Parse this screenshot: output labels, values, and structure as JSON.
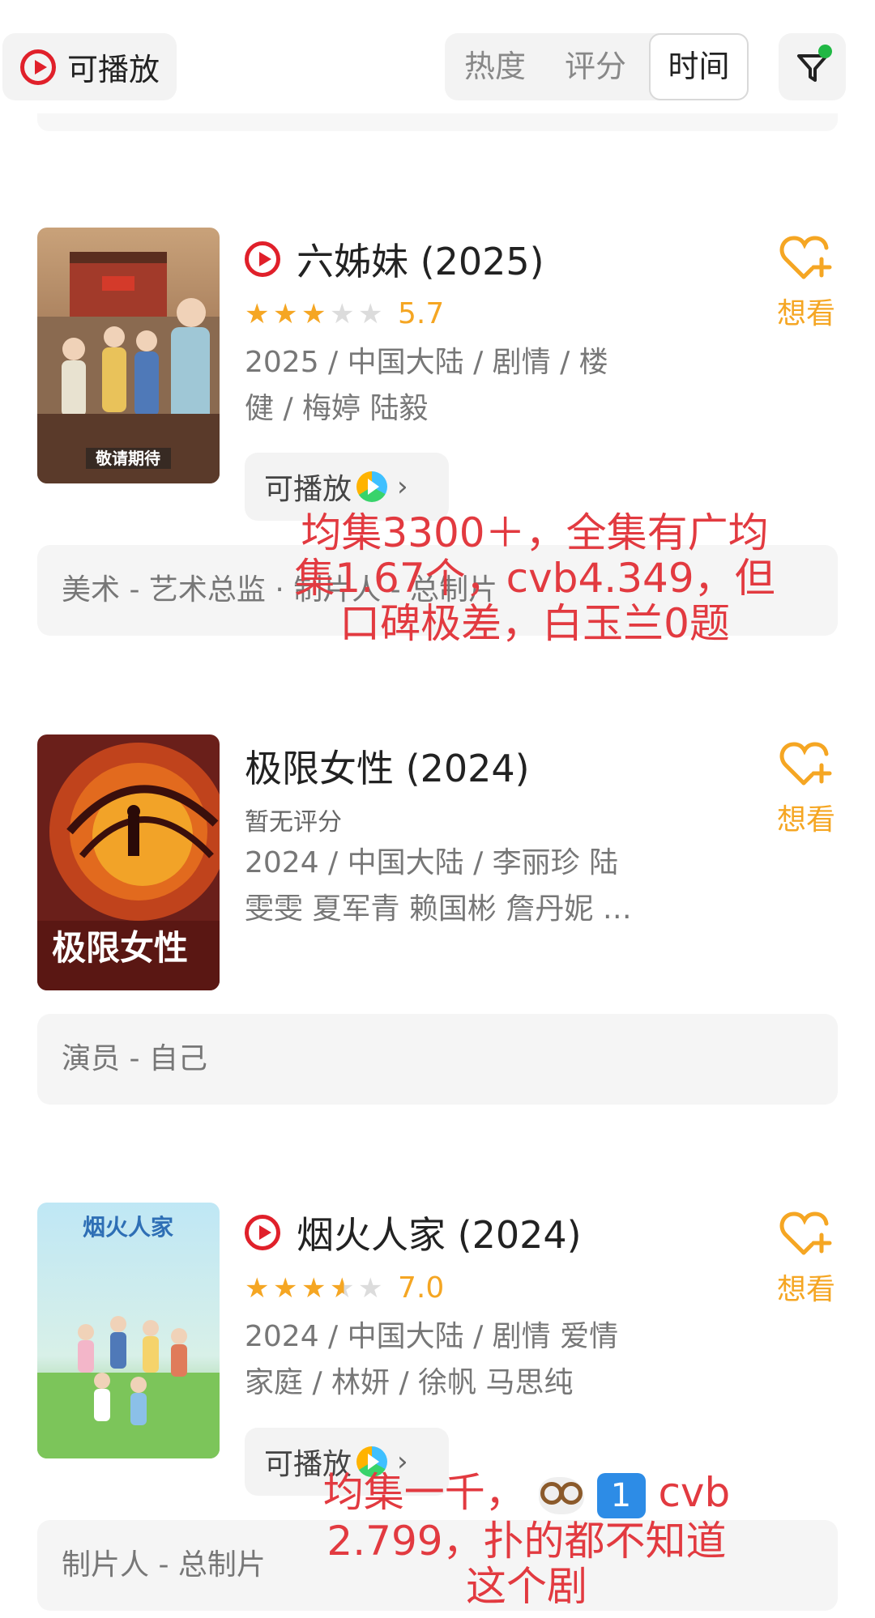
{
  "filter_bar": {
    "playable_label": "可播放",
    "sort_tabs": [
      "热度",
      "评分",
      "时间"
    ],
    "active_sort": "时间",
    "filter_icon": "filter-icon",
    "filter_dot_color": "#20b844"
  },
  "colors": {
    "accent": "#f5a623",
    "play_red": "#e0202a",
    "annotation_red": "#e23a40"
  },
  "items": [
    {
      "title": "六姊妹 (2025)",
      "has_play_badge": true,
      "rating_stars": 3,
      "score": "5.7",
      "info_line1": "2025 / 中国大陆 / 剧情 / 楼",
      "info_line2": "健 / 梅婷 陆毅",
      "play_chip": "可播放",
      "wish_label": "想看",
      "role": "美术 - 艺术总监 · 制片人 - 总制片",
      "poster_text": "敬请期待"
    },
    {
      "title": "极限女性 (2024)",
      "has_play_badge": false,
      "no_rating": "暂无评分",
      "info_line1": "2024 / 中国大陆 / 李丽珍 陆",
      "info_line2": "雯雯 夏军青 赖国彬 詹丹妮 …",
      "wish_label": "想看",
      "role": "演员 - 自己",
      "poster_text": "极限女性"
    },
    {
      "title": "烟火人家 (2024)",
      "has_play_badge": true,
      "rating_stars": 3.5,
      "score": "7.0",
      "info_line1": "2024 / 中国大陆 / 剧情 爱情",
      "info_line2": "家庭 / 林妍 / 徐帆 马思纯",
      "play_chip": "可播放",
      "wish_label": "想看",
      "role": "制片人 - 总制片",
      "poster_text": "烟火人家"
    }
  ],
  "annotations": {
    "a1_line1": "均集3300＋，全集有广均",
    "a1_line2": "集1.67个，cvb4.349，但",
    "a1_line3": "口碑极差，白玉兰0题",
    "a2_line1_a": "均集一千，",
    "a2_line1_b": "cvb",
    "a2_line2": "2.799，扑的都不知道",
    "a2_line3": "这个剧",
    "a2_keycap": "1"
  }
}
